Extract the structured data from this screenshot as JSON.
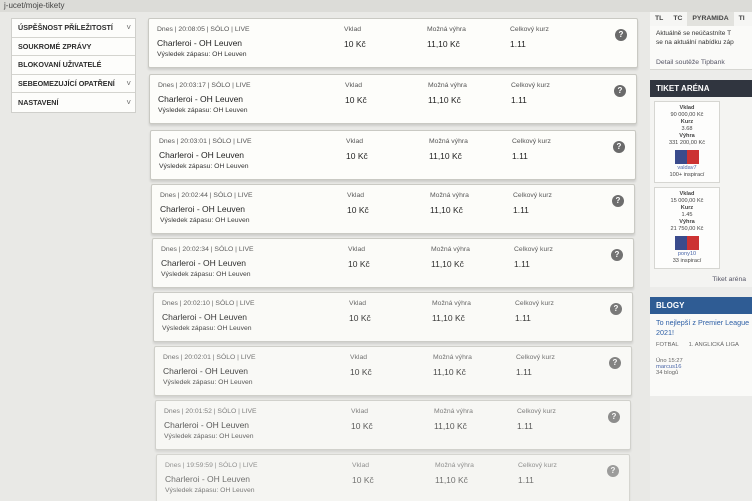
{
  "url": "j-ucet/moje-tikety",
  "left_menu": [
    {
      "label": "ÚSPĚŠNOST PŘÍLEŽITOSTÍ",
      "arrow": "˅"
    },
    {
      "label": "SOUKROMÉ ZPRÁVY",
      "arrow": ""
    },
    {
      "label": "BLOKOVANÍ UŽIVATELÉ",
      "arrow": ""
    },
    {
      "label": "SEBEOMEZUJÍCÍ OPATŘENÍ",
      "arrow": "˅"
    },
    {
      "label": "NASTAVENÍ",
      "arrow": "˅"
    }
  ],
  "ticket_labels": {
    "stake": "Vklad",
    "win": "Možná výhra",
    "odds": "Celkový kurz",
    "help": "?"
  },
  "tickets": [
    {
      "meta": "Dnes | 20:08:05 | SÓLO | LIVE",
      "match": "Charleroi - OH Leuven",
      "result": "Výsledek zápasu: OH Leuven",
      "stake": "10 Kč",
      "win": "11,10 Kč",
      "odds": "1.11"
    },
    {
      "meta": "Dnes | 20:03:17 | SÓLO | LIVE",
      "match": "Charleroi - OH Leuven",
      "result": "Výsledek zápasu: OH Leuven",
      "stake": "10 Kč",
      "win": "11,10 Kč",
      "odds": "1.11"
    },
    {
      "meta": "Dnes | 20:03:01 | SÓLO | LIVE",
      "match": "Charleroi - OH Leuven",
      "result": "Výsledek zápasu: OH Leuven",
      "stake": "10 Kč",
      "win": "11,10 Kč",
      "odds": "1.11"
    },
    {
      "meta": "Dnes | 20:02:44 | SÓLO | LIVE",
      "match": "Charleroi - OH Leuven",
      "result": "Výsledek zápasu: OH Leuven",
      "stake": "10 Kč",
      "win": "11,10 Kč",
      "odds": "1.11"
    },
    {
      "meta": "Dnes | 20:02:34 | SÓLO | LIVE",
      "match": "Charleroi - OH Leuven",
      "result": "Výsledek zápasu: OH Leuven",
      "stake": "10 Kč",
      "win": "11,10 Kč",
      "odds": "1.11"
    },
    {
      "meta": "Dnes | 20:02:10 | SÓLO | LIVE",
      "match": "Charleroi - OH Leuven",
      "result": "Výsledek zápasu: OH Leuven",
      "stake": "10 Kč",
      "win": "11,10 Kč",
      "odds": "1.11"
    },
    {
      "meta": "Dnes | 20:02:01 | SÓLO | LIVE",
      "match": "Charleroi - OH Leuven",
      "result": "Výsledek zápasu: OH Leuven",
      "stake": "10 Kč",
      "win": "11,10 Kč",
      "odds": "1.11"
    },
    {
      "meta": "Dnes | 20:01:52 | SÓLO | LIVE",
      "match": "Charleroi - OH Leuven",
      "result": "Výsledek zápasu: OH Leuven",
      "stake": "10 Kč",
      "win": "11,10 Kč",
      "odds": "1.11"
    },
    {
      "meta": "Dnes | 19:59:59 | SÓLO | LIVE",
      "match": "Charleroi - OH Leuven",
      "result": "Výsledek zápasu: OH Leuven",
      "stake": "10 Kč",
      "win": "11,10 Kč",
      "odds": "1.11"
    }
  ],
  "right": {
    "tabs": [
      "TL",
      "TC",
      "PYRAMIDA",
      "TI"
    ],
    "note_lines": [
      "Aktuálně se neúčastníte T",
      "se na aktuální nabídku záp"
    ],
    "contest_link": "Detail soutěže Tipbank",
    "arena_title": "TIKET ARÉNA",
    "arena_cards": [
      {
        "l1": "Vklad",
        "v1": "90 000,00 Kč",
        "l2": "Kurz",
        "v2": "3.68",
        "l3": "Výhra",
        "v3": "331 200,00 Kč",
        "user": "valdav7",
        "sub": "100+ inspirací"
      },
      {
        "l1": "Vklad",
        "v1": "15 000,00 Kč",
        "l2": "Kurz",
        "v2": "1.45",
        "l3": "Výhra",
        "v3": "21 750,00 Kč",
        "user": "pony10",
        "sub": "33 inspirací"
      }
    ],
    "arena_link": "Tiket aréna",
    "blogs_title": "BLOGY",
    "blog_post_title_1": "To nejlepší z Premier League",
    "blog_post_title_2": "2021!",
    "blog_tags": [
      "FOTBAL",
      "1. ANGLICKÁ LIGA"
    ],
    "blog_date": "Úno 15:27",
    "blog_author": "marcus16",
    "blog_author_sub": "34 blogů"
  }
}
